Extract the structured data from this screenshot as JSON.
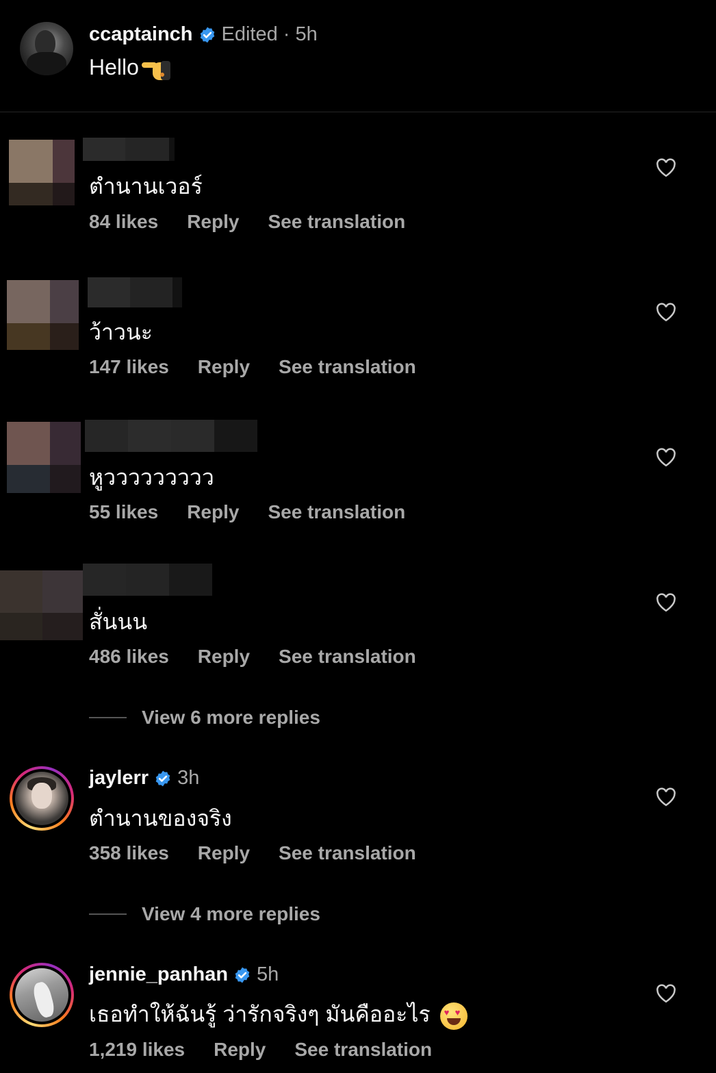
{
  "caption": {
    "username": "ccaptainch",
    "meta": "Edited · 5h",
    "text": "Hello",
    "emoji": "pointing-hand-emoji"
  },
  "comments": [
    {
      "text": "ตำนานเวอร์",
      "likes": "84 likes",
      "reply": "Reply",
      "translate": "See translation"
    },
    {
      "text": "ว้าวนะ",
      "likes": "147 likes",
      "reply": "Reply",
      "translate": "See translation"
    },
    {
      "text": "หูววววววววว",
      "likes": "55 likes",
      "reply": "Reply",
      "translate": "See translation"
    },
    {
      "text": "สั่นนน",
      "likes": "486 likes",
      "reply": "Reply",
      "translate": "See translation"
    },
    {
      "username": "jaylerr",
      "time": "3h",
      "text": "ตำนานของจริง",
      "likes": "358 likes",
      "reply": "Reply",
      "translate": "See translation"
    },
    {
      "username": "jennie_panhan",
      "time": "5h",
      "text": "เธอทำให้ฉันรู้ ว่ารักจริงๆ มันคืออะไร",
      "likes": "1,219 likes",
      "reply": "Reply",
      "translate": "See translation"
    }
  ],
  "view_more": [
    "View 6 more replies",
    "View 4 more replies"
  ],
  "colors": {
    "background": "#000000",
    "primary_text": "#f5f5f5",
    "secondary_text": "#a8a8a8",
    "verified": "#3897f0"
  }
}
